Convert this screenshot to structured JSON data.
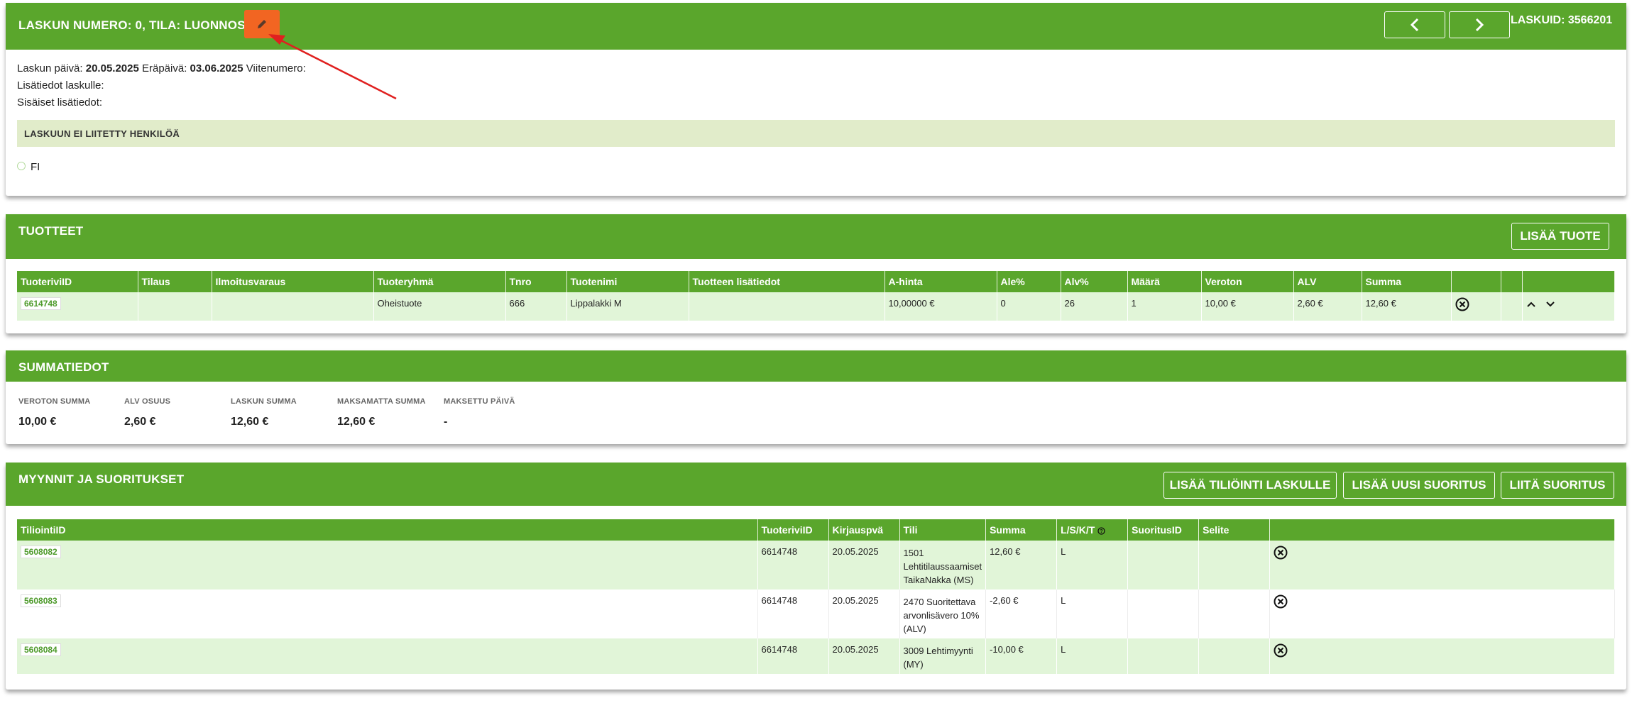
{
  "header": {
    "title": "LASKUN NUMERO: 0, TILA: LUONNOS",
    "laskuid": "LASKUID: 3566201",
    "prev_icon": "chevron-left-icon",
    "next_icon": "chevron-right-icon",
    "edit_icon": "pencil-icon"
  },
  "info": {
    "date_label": "Laskun päivä:",
    "date_value": "20.05.2025",
    "due_label": "Eräpäivä:",
    "due_value": "03.06.2025",
    "ref_label": "Viitenumero:",
    "extra_label": "Lisätiedot laskulle:",
    "internal_label": "Sisäiset lisätiedot:",
    "no_person": "LASKUUN EI LIITETTY HENKILÖÄ",
    "language": "FI"
  },
  "products": {
    "title": "TUOTTEET",
    "add_button": "LISÄÄ TUOTE",
    "columns": [
      "TuoteriviID",
      "Tilaus",
      "Ilmoitusvaraus",
      "Tuoteryhmä",
      "Tnro",
      "Tuotenimi",
      "Tuotteen lisätiedot",
      "A-hinta",
      "Ale%",
      "Alv%",
      "Määrä",
      "Veroton",
      "ALV",
      "Summa",
      "",
      "",
      ""
    ],
    "rows": [
      {
        "id": "6614748",
        "tilaus": "",
        "ilmoitus": "",
        "ryhma": "Oheistuote",
        "tnro": "666",
        "nimi": "Lippalakki M",
        "lisatiedot": "",
        "ahinta": "10,00000 €",
        "ale": "0",
        "alv_pct": "26",
        "maara": "1",
        "veroton": "10,00 €",
        "alv": "2,60 €",
        "summa": "12,60 €"
      }
    ]
  },
  "summary": {
    "title": "SUMMATIEDOT",
    "items": [
      {
        "label": "VEROTON SUMMA",
        "value": "10,00 €"
      },
      {
        "label": "ALV OSUUS",
        "value": "2,60 €"
      },
      {
        "label": "LASKUN SUMMA",
        "value": "12,60 €"
      },
      {
        "label": "MAKSAMATTA SUMMA",
        "value": "12,60 €"
      },
      {
        "label": "MAKSETTU PÄIVÄ",
        "value": "-"
      }
    ]
  },
  "sales": {
    "title": "MYYNNIT JA SUORITUKSET",
    "buttons": [
      "LISÄÄ TILIÖINTI LASKULLE",
      "LISÄÄ UUSI SUORITUS",
      "LIITÄ SUORITUS"
    ],
    "columns": [
      "TiliointiID",
      "TuoteriviID",
      "Kirjauspvä",
      "Tili",
      "Summa",
      "L/S/K/T",
      "SuoritusID",
      "Selite",
      ""
    ],
    "rows": [
      {
        "id": "5608082",
        "tuoterivi": "6614748",
        "pvm": "20.05.2025",
        "tili_lines": [
          "1501",
          "Lehtitilaussaamiset",
          "TaikaNakka (MS)"
        ],
        "summa": "12,60 €",
        "lskt": "L",
        "suoritus": "",
        "selite": ""
      },
      {
        "id": "5608083",
        "tuoterivi": "6614748",
        "pvm": "20.05.2025",
        "tili_lines": [
          "2470 Suoritettava",
          "arvonlisävero 10%",
          "(ALV)"
        ],
        "summa": "-2,60 €",
        "lskt": "L",
        "suoritus": "",
        "selite": ""
      },
      {
        "id": "5608084",
        "tuoterivi": "6614748",
        "pvm": "20.05.2025",
        "tili_lines": [
          "3009 Lehtimyynti",
          "(MY)"
        ],
        "summa": "-10,00 €",
        "lskt": "L",
        "suoritus": "",
        "selite": ""
      }
    ]
  },
  "colors": {
    "green": "#5aa62c",
    "light_green": "#e1f5d8",
    "orange": "#f26522",
    "annotation": "#e0201f"
  }
}
